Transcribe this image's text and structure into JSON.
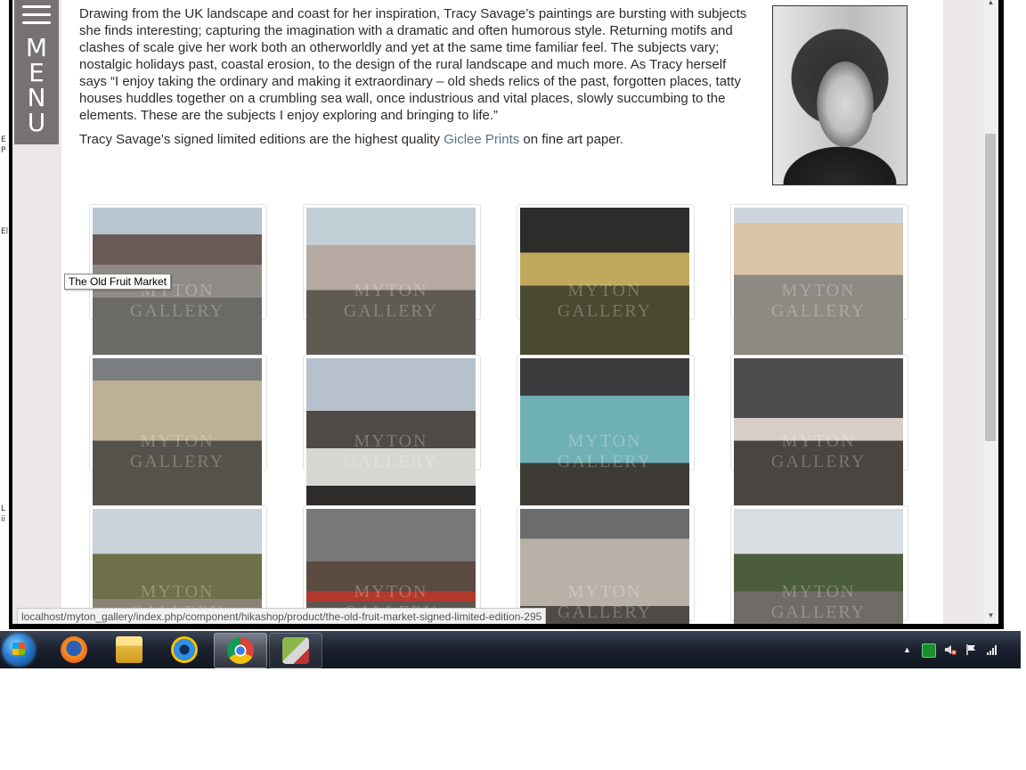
{
  "intro": {
    "paragraph1": "Drawing from the UK landscape and coast for her inspiration, Tracy Savage’s paintings are bursting with subjects she finds interesting; capturing the imagination with a dramatic and often humorous style. Returning motifs and clashes of scale give her work both an otherworldly and yet at the same time familiar feel. The subjects vary; nostalgic holidays past, coastal erosion, to the design of the rural landscape and much more. As Tracy herself says “I enjoy taking the ordinary and making it extraordinary – old sheds relics of the past, forgotten places, tatty houses huddles together on a crumbling sea wall, once industrious and vital places, slowly succumbing to the elements. These are the subjects I enjoy exploring and bringing to life.”",
    "paragraph2_before": "Tracy Savage's signed limited editions are the highest quality ",
    "paragraph2_link": "Giclee Prints",
    "paragraph2_after": " on fine art paper."
  },
  "menu": {
    "letters": [
      "M",
      "E",
      "N",
      "U"
    ]
  },
  "gallery": {
    "watermark": "MYTON GALLERY",
    "tooltip": "The Old Fruit Market",
    "items": [
      {
        "name": "the-old-fruit-market"
      },
      {
        "name": "painting-2"
      },
      {
        "name": "painting-3"
      },
      {
        "name": "painting-4"
      },
      {
        "name": "painting-5"
      },
      {
        "name": "painting-6"
      },
      {
        "name": "painting-7"
      },
      {
        "name": "painting-8"
      },
      {
        "name": "painting-9"
      },
      {
        "name": "painting-10"
      },
      {
        "name": "painting-11"
      },
      {
        "name": "painting-12"
      }
    ]
  },
  "status": {
    "url": "localhost/myton_gallery/index.php/component/hikashop/product/the-old-fruit-market-signed-limited-edition-295"
  },
  "desktop_fragments": [
    "E",
    "P",
    "El",
    "L",
    "ii"
  ],
  "taskbar": {
    "icons": [
      "firefox-icon",
      "explorer-icon",
      "internet-explorer-icon",
      "chrome-icon",
      "network-app-icon"
    ],
    "tray": [
      "arrow-up-icon",
      "green-app-icon",
      "speaker-muted-icon",
      "action-center-flag-icon",
      "signal-bars-icon"
    ]
  },
  "colors": {
    "menu_bg": "#767272",
    "page_bg": "#ece7ea",
    "link": "#5b7386",
    "text": "#2b2b2b"
  }
}
